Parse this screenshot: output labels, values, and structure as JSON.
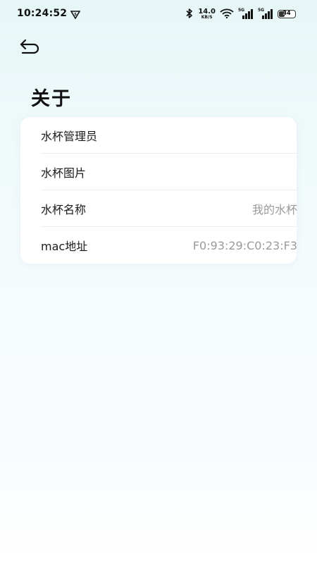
{
  "status_bar": {
    "time": "10:24:52",
    "net_speed": "14.0",
    "net_speed_unit": "KB/S",
    "sim1_label": "5G",
    "sim2_label": "5G",
    "battery_level": "34",
    "battery_fraction": 0.34
  },
  "header": {
    "title": "关于"
  },
  "info_card": {
    "rows": [
      {
        "label": "水杯管理员",
        "value": ""
      },
      {
        "label": "水杯图片",
        "value": ""
      },
      {
        "label": "水杯名称",
        "value": "我的水杯"
      },
      {
        "label": "mac地址",
        "value": "F0:93:29:C0:23:F3"
      }
    ]
  },
  "colors": {
    "background_top": "#e6f6f6",
    "background_bottom": "#ffffff",
    "card": "#ffffff",
    "label_text": "#1a1a1a",
    "value_text": "#9a9a9a"
  }
}
